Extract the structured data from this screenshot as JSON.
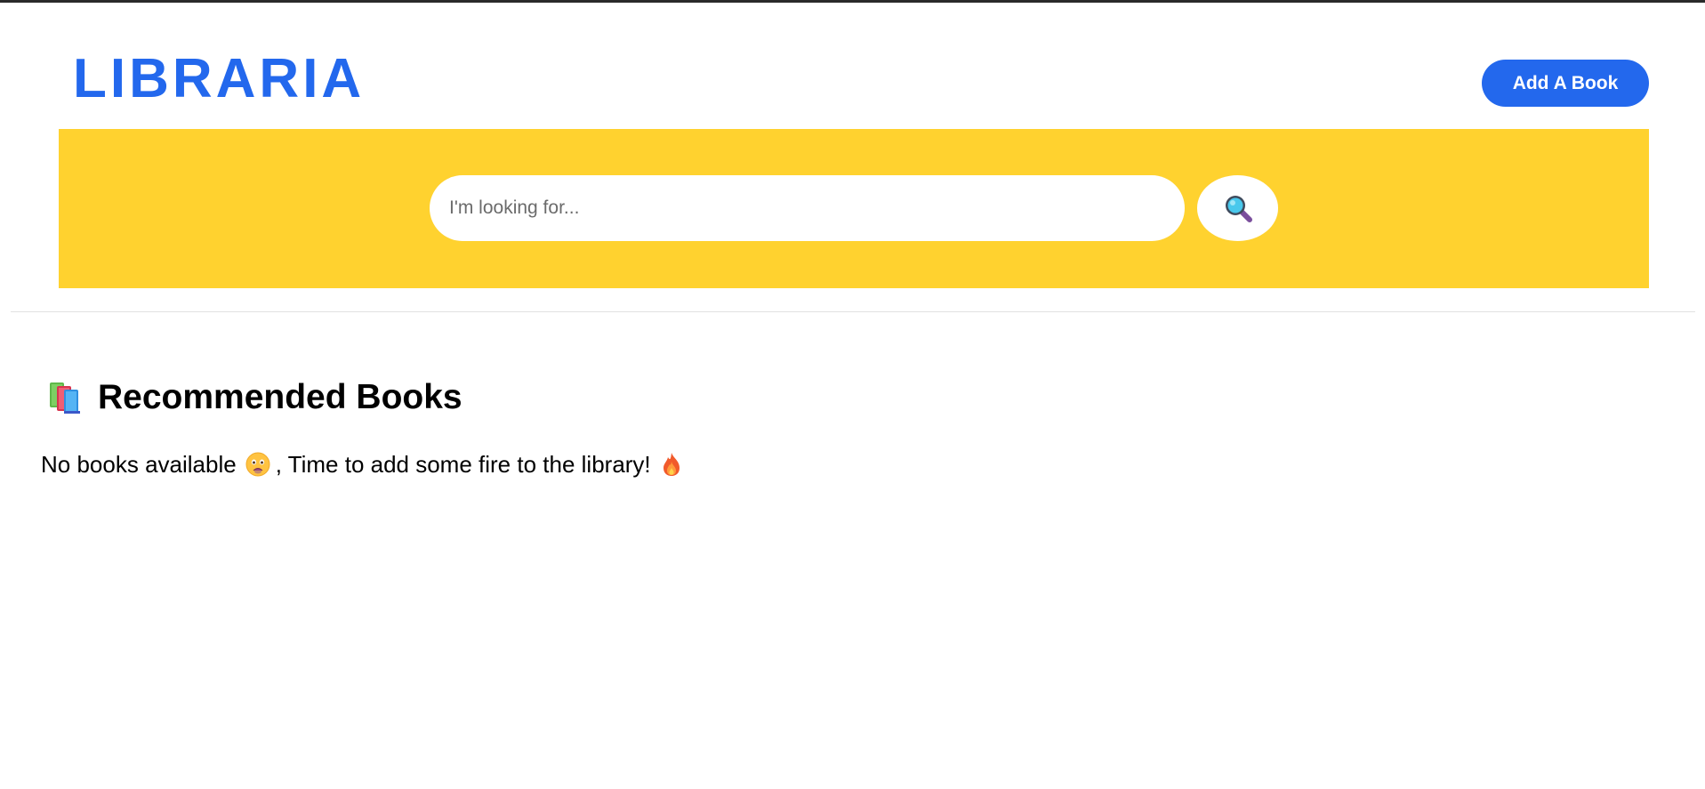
{
  "colors": {
    "brand": "#2368ed",
    "banner": "#ffd22f",
    "button_text": "#ffffff"
  },
  "header": {
    "logo": "LIBRARIA",
    "add_book_label": "Add A Book"
  },
  "search": {
    "placeholder": "I'm looking for...",
    "button_icon": "magnifying-glass-icon"
  },
  "main": {
    "section_icon": "books-icon",
    "section_title": "Recommended Books",
    "empty_message_part1": "No books available",
    "empty_message_emoji": "sad-face-icon",
    "empty_message_part2": ", Time to add some fire to the library!",
    "empty_message_emoji_end": "fire-icon"
  }
}
